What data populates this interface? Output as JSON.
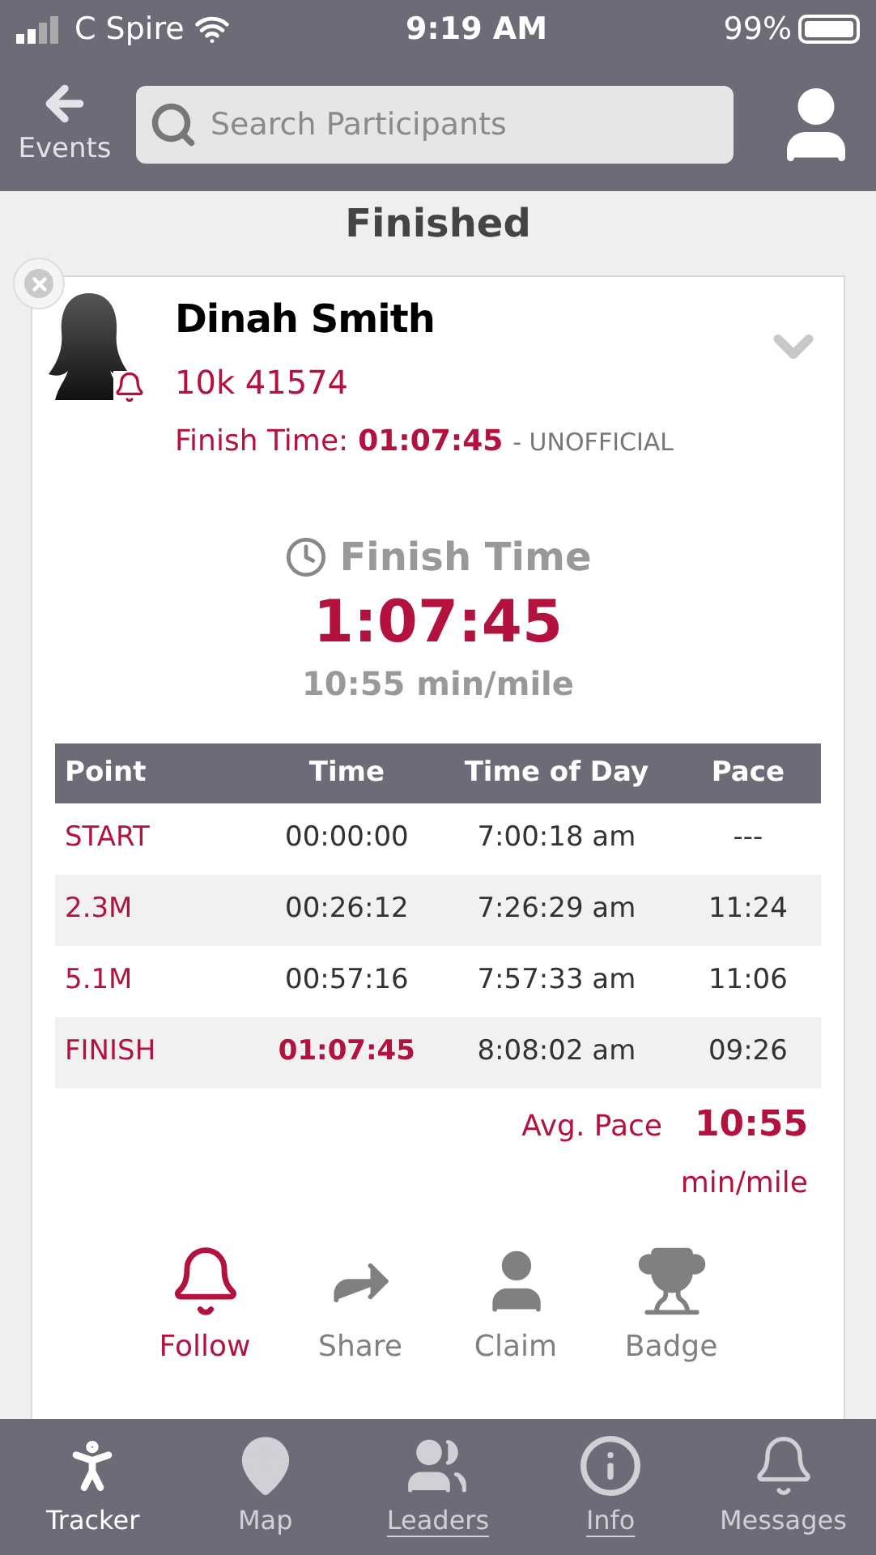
{
  "status_bar": {
    "carrier": "C Spire",
    "time": "9:19 AM",
    "battery": "99%"
  },
  "header": {
    "back_label": "Events",
    "search": {
      "placeholder": "Search Participants"
    }
  },
  "section_title": "Finished",
  "participant": {
    "name": "Dinah Smith",
    "bib": "10k 41574",
    "finish_label": "Finish Time:",
    "finish_value": "01:07:45",
    "finish_note": "- UNOFFICIAL"
  },
  "summary": {
    "title": "Finish Time",
    "time": "1:07:45",
    "pace": "10:55 min/mile"
  },
  "table": {
    "columns": [
      "Point",
      "Time",
      "Time of Day",
      "Pace"
    ],
    "rows": [
      {
        "cells": [
          "START",
          "00:00:00",
          "7:00:18 am",
          "---"
        ],
        "emphasized": false
      },
      {
        "cells": [
          "2.3M",
          "00:26:12",
          "7:26:29 am",
          "11:24"
        ],
        "emphasized": false
      },
      {
        "cells": [
          "5.1M",
          "00:57:16",
          "7:57:33 am",
          "11:06"
        ],
        "emphasized": false
      },
      {
        "cells": [
          "FINISH",
          "01:07:45",
          "8:08:02 am",
          "09:26"
        ],
        "emphasized": true
      }
    ]
  },
  "avg_pace": {
    "label": "Avg. Pace",
    "value": "10:55",
    "unit": "min/mile"
  },
  "actions": [
    {
      "kind": "bell",
      "label": "Follow",
      "selected": true
    },
    {
      "kind": "share",
      "label": "Share",
      "selected": false
    },
    {
      "kind": "person",
      "label": "Claim",
      "selected": false
    },
    {
      "kind": "trophy",
      "label": "Badge",
      "selected": false
    }
  ],
  "tab_bar": [
    {
      "kind": "runner",
      "label": "Tracker",
      "selected": true,
      "underlined": false
    },
    {
      "kind": "pin",
      "label": "Map",
      "selected": false,
      "underlined": false
    },
    {
      "kind": "group",
      "label": "Leaders",
      "selected": false,
      "underlined": true
    },
    {
      "kind": "info",
      "label": "Info",
      "selected": false,
      "underlined": true
    },
    {
      "kind": "bell",
      "label": "Messages",
      "selected": false,
      "underlined": false
    }
  ]
}
